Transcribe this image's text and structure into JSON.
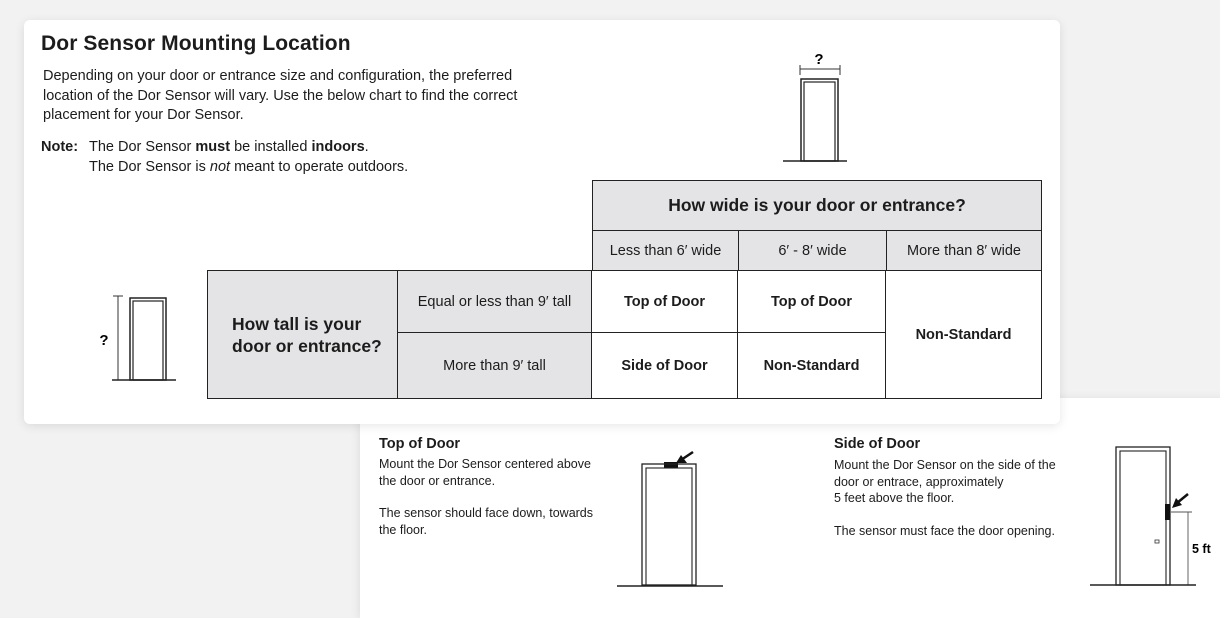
{
  "header": {
    "title": "Dor Sensor Mounting Location",
    "intro": "Depending on your door or entrance size and configuration, the preferred location of the Dor Sensor will vary. Use the below chart to find the correct placement for your Dor Sensor."
  },
  "note": {
    "label": "Note:",
    "line1_pre": "The Dor Sensor ",
    "line1_bold1": "must",
    "line1_mid": " be installed ",
    "line1_bold2": "indoors",
    "line1_end": ".",
    "line2_pre": "The Dor Sensor is ",
    "line2_italic": "not",
    "line2_end": " meant to operate outdoors."
  },
  "width_diagram": {
    "label": "?"
  },
  "height_diagram": {
    "label": "?"
  },
  "table": {
    "width_question": "How wide is your door or entrance?",
    "width_columns": [
      "Less than 6′ wide",
      "6′ - 8′ wide",
      "More than 8′ wide"
    ],
    "height_question": "How tall is your door or entrance?",
    "height_rows": [
      "Equal or less than 9′ tall",
      "More than 9′ tall"
    ],
    "cells": {
      "r1c1": "Top of Door",
      "r1c2": "Top of Door",
      "c3": "Non-Standard",
      "r2c1": "Side of Door",
      "r2c2": "Non-Standard"
    }
  },
  "top_of_door": {
    "title": "Top of Door",
    "p1": "Mount the Dor Sensor centered above the door or entrance.",
    "p2": "The sensor should face down, towards the floor."
  },
  "side_of_door": {
    "title": "Side of Door",
    "p1a": "Mount the Dor Sensor on the side of the door or entrace, approximately",
    "p1b": "5 feet above the floor.",
    "p2": "The sensor must face the door opening.",
    "height_label": "5 ft"
  }
}
